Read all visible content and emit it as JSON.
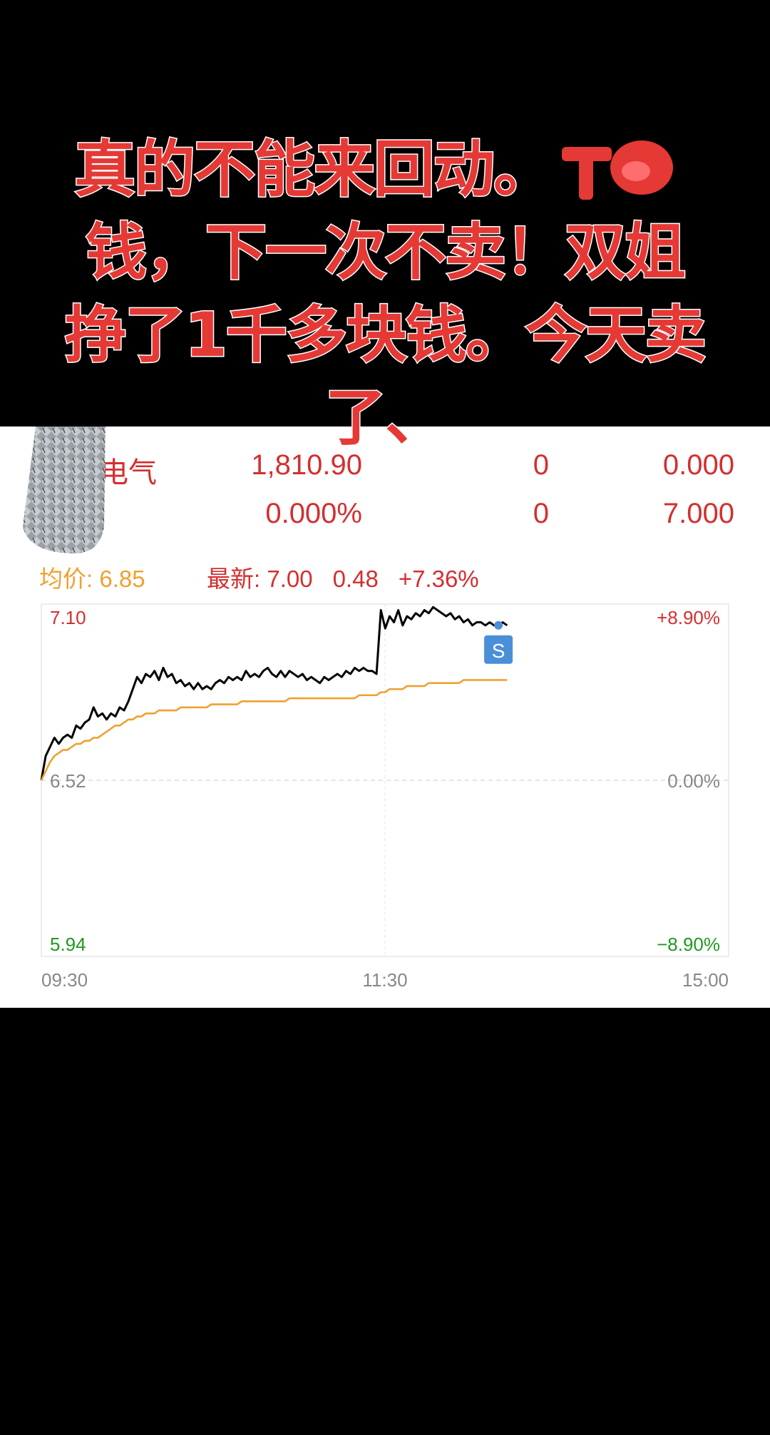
{
  "caption": {
    "line1": "真的不能来回动。",
    "line2": "钱，下一次不卖！双姐",
    "line3": "挣了1千多块钱。今天卖",
    "line4": "了、"
  },
  "quote_table": {
    "name": "电气",
    "row1": [
      "1,810.90",
      "0",
      "0.000"
    ],
    "row2": [
      "0.000%",
      "0",
      "7.000"
    ]
  },
  "quote": {
    "avg_label": "均价: 6.85",
    "latest_label": "最新: 7.00",
    "change": "0.48",
    "change_pct": "+7.36%"
  },
  "chart_data": {
    "type": "line",
    "x_tick_labels": [
      "09:30",
      "11:30",
      "15:00"
    ],
    "ylim": [
      5.94,
      7.1
    ],
    "y_labels_left": [
      "7.10",
      "6.52",
      "5.94"
    ],
    "y_labels_right": [
      "+8.90%",
      "0.00%",
      "−8.90%"
    ],
    "prev_close": 6.52,
    "grid": true,
    "marker_label": "S",
    "series": [
      {
        "color": "#000000",
        "values": [
          6.52,
          6.6,
          6.63,
          6.66,
          6.64,
          6.66,
          6.67,
          6.66,
          6.7,
          6.69,
          6.71,
          6.72,
          6.76,
          6.73,
          6.74,
          6.72,
          6.74,
          6.73,
          6.76,
          6.75,
          6.78,
          6.82,
          6.86,
          6.84,
          6.87,
          6.86,
          6.88,
          6.85,
          6.89,
          6.86,
          6.87,
          6.84,
          6.85,
          6.83,
          6.84,
          6.82,
          6.84,
          6.82,
          6.83,
          6.82,
          6.84,
          6.85,
          6.84,
          6.86,
          6.85,
          6.86,
          6.85,
          6.88,
          6.86,
          6.87,
          6.86,
          6.88,
          6.89,
          6.87,
          6.86,
          6.88,
          6.86,
          6.88,
          6.87,
          6.86,
          6.87,
          6.85,
          6.86,
          6.85,
          6.84,
          6.86,
          6.85,
          6.86,
          6.87,
          6.86,
          6.88,
          6.87,
          6.89,
          6.88,
          6.89,
          6.88,
          6.88,
          6.87,
          7.08,
          7.02,
          7.06,
          7.04,
          7.08,
          7.03,
          7.06,
          7.05,
          7.07,
          7.06,
          7.08,
          7.07,
          7.09,
          7.08,
          7.07,
          7.06,
          7.07,
          7.05,
          7.06,
          7.04,
          7.05,
          7.03,
          7.04,
          7.04,
          7.03,
          7.04,
          7.03,
          7.03,
          7.04,
          7.03
        ]
      },
      {
        "color": "#f0a030",
        "values": [
          6.52,
          6.55,
          6.58,
          6.6,
          6.61,
          6.62,
          6.62,
          6.63,
          6.64,
          6.64,
          6.65,
          6.65,
          6.66,
          6.66,
          6.67,
          6.68,
          6.69,
          6.7,
          6.7,
          6.71,
          6.72,
          6.72,
          6.73,
          6.73,
          6.74,
          6.74,
          6.74,
          6.75,
          6.75,
          6.75,
          6.75,
          6.75,
          6.76,
          6.76,
          6.76,
          6.76,
          6.76,
          6.76,
          6.76,
          6.77,
          6.77,
          6.77,
          6.77,
          6.77,
          6.77,
          6.77,
          6.78,
          6.78,
          6.78,
          6.78,
          6.78,
          6.78,
          6.78,
          6.78,
          6.78,
          6.78,
          6.78,
          6.79,
          6.79,
          6.79,
          6.79,
          6.79,
          6.79,
          6.79,
          6.79,
          6.79,
          6.79,
          6.79,
          6.79,
          6.79,
          6.79,
          6.79,
          6.79,
          6.8,
          6.8,
          6.8,
          6.8,
          6.8,
          6.81,
          6.81,
          6.82,
          6.82,
          6.82,
          6.82,
          6.83,
          6.83,
          6.83,
          6.83,
          6.83,
          6.84,
          6.84,
          6.84,
          6.84,
          6.84,
          6.84,
          6.84,
          6.84,
          6.85,
          6.85,
          6.85,
          6.85,
          6.85,
          6.85,
          6.85,
          6.85,
          6.85,
          6.85,
          6.85
        ]
      }
    ]
  },
  "emojis": [
    "😄",
    "😄",
    "😄",
    "😄",
    "😄"
  ],
  "colors": {
    "red": "#d32f2f",
    "green": "#1e9a1e",
    "orange": "#f0a030",
    "grey": "#888888"
  }
}
